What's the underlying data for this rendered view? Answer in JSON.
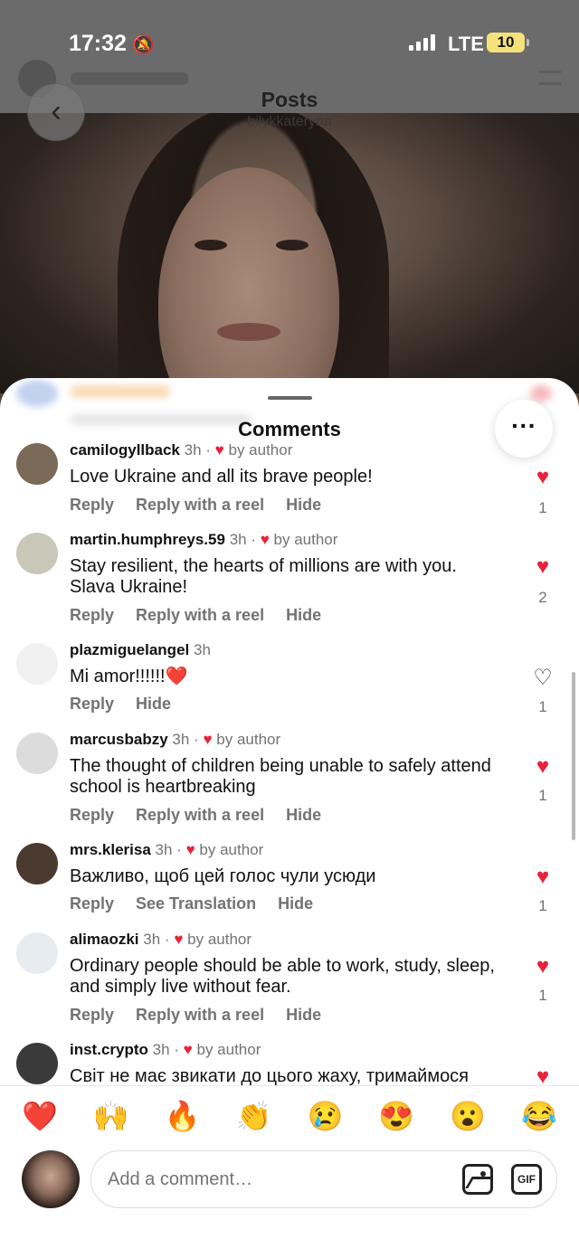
{
  "status_bar": {
    "time": "17:32",
    "network": "LTE",
    "battery": "10"
  },
  "header": {
    "title": "Posts",
    "subtitle": "bilykkateryna"
  },
  "sheet": {
    "title": "Comments"
  },
  "comments": [
    {
      "username": "camilogyllback",
      "time": "3h",
      "liked_by_author": true,
      "author_label": "by author",
      "text": "Love Ukraine and all its brave people!",
      "actions": [
        "Reply",
        "Reply with a reel",
        "Hide"
      ],
      "liked": true,
      "likes": "1",
      "avatar_color": "#7b6a58"
    },
    {
      "username": "martin.humphreys.59",
      "time": "3h",
      "liked_by_author": true,
      "author_label": "by author",
      "text": "Stay resilient, the hearts of millions are with you. Slava Ukraine!",
      "actions": [
        "Reply",
        "Reply with a reel",
        "Hide"
      ],
      "liked": true,
      "likes": "2",
      "avatar_color": "#c9c7b8"
    },
    {
      "username": "plazmiguelangel",
      "time": "3h",
      "liked_by_author": false,
      "author_label": "",
      "text": "Mi amor!!!!!!❤️",
      "actions": [
        "Reply",
        "Hide"
      ],
      "liked": false,
      "likes": "1",
      "avatar_color": "#f1f1f1"
    },
    {
      "username": "marcusbabzy",
      "time": "3h",
      "liked_by_author": true,
      "author_label": "by author",
      "text": "The thought of children being unable to safely attend school is heartbreaking",
      "actions": [
        "Reply",
        "Reply with a reel",
        "Hide"
      ],
      "liked": true,
      "likes": "1",
      "avatar_color": "#dcdcdc"
    },
    {
      "username": "mrs.klerisa",
      "time": "3h",
      "liked_by_author": true,
      "author_label": "by author",
      "text": "Важливо, щоб цей голос чули усюди",
      "actions": [
        "Reply",
        "See Translation",
        "Hide"
      ],
      "liked": true,
      "likes": "1",
      "avatar_color": "#4a3a30"
    },
    {
      "username": "alimaozki",
      "time": "3h",
      "liked_by_author": true,
      "author_label": "by author",
      "text": "Ordinary people should be able to work, study, sleep, and simply live without fear.",
      "actions": [
        "Reply",
        "Reply with a reel",
        "Hide"
      ],
      "liked": true,
      "likes": "1",
      "avatar_color": "#e6ecf0"
    },
    {
      "username": "inst.crypto",
      "time": "3h",
      "liked_by_author": true,
      "author_label": "by author",
      "text": "Світ не має звикати до цього жаху, тримаймося",
      "actions": [],
      "liked": true,
      "likes": "",
      "avatar_color": "#3a3a3a"
    }
  ],
  "emoji_bar": [
    "❤️",
    "🙌",
    "🔥",
    "👏",
    "😢",
    "😍",
    "😮",
    "😂"
  ],
  "composer": {
    "placeholder": "Add a comment…",
    "gif_label": "GIF"
  },
  "colors": {
    "heart": "#e8223a",
    "meta_gray": "#737373"
  }
}
